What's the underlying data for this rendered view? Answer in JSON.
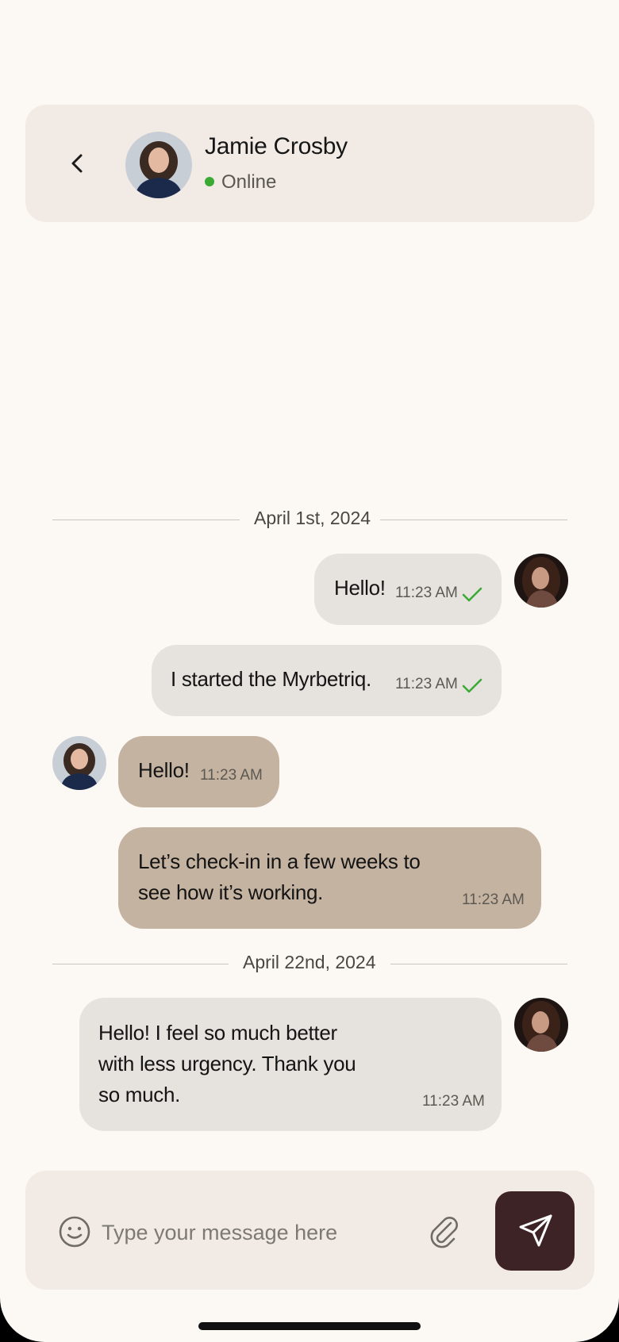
{
  "header": {
    "contact_name": "Jamie Crosby",
    "status": "Online",
    "status_color": "#3aaa35"
  },
  "conversation": {
    "date_dividers": [
      "April 1st, 2024",
      "April 22nd, 2024"
    ],
    "messages": [
      {
        "direction": "outgoing",
        "text": "Hello!",
        "time": "11:23 AM",
        "read_check": true
      },
      {
        "direction": "outgoing",
        "text": "I started the Myrbetriq.",
        "time": "11:23 AM",
        "read_check": true
      },
      {
        "direction": "incoming",
        "text": "Hello!",
        "time": "11:23 AM"
      },
      {
        "direction": "incoming",
        "lines": [
          "Let’s check-in in a few weeks to",
          "see how it’s working."
        ],
        "time": "11:23 AM"
      },
      {
        "direction": "outgoing",
        "lines": [
          "Hello! I feel so much better",
          "with less urgency. Thank you",
          "so much."
        ],
        "time": "11:23 AM"
      }
    ]
  },
  "composer": {
    "placeholder": "Type your message here",
    "value": ""
  },
  "icons": {
    "back": "chevron-left-icon",
    "emoji": "smiley-icon",
    "attach": "paperclip-icon",
    "send": "paper-plane-icon",
    "read": "checkmark-icon"
  },
  "colors": {
    "background": "#fcf8f4",
    "header_bg": "#f2ebe5",
    "outgoing_bubble": "#e6e2dd",
    "incoming_bubble": "#c5b3a1",
    "send_button": "#3e2326",
    "check": "#3aaa35"
  }
}
